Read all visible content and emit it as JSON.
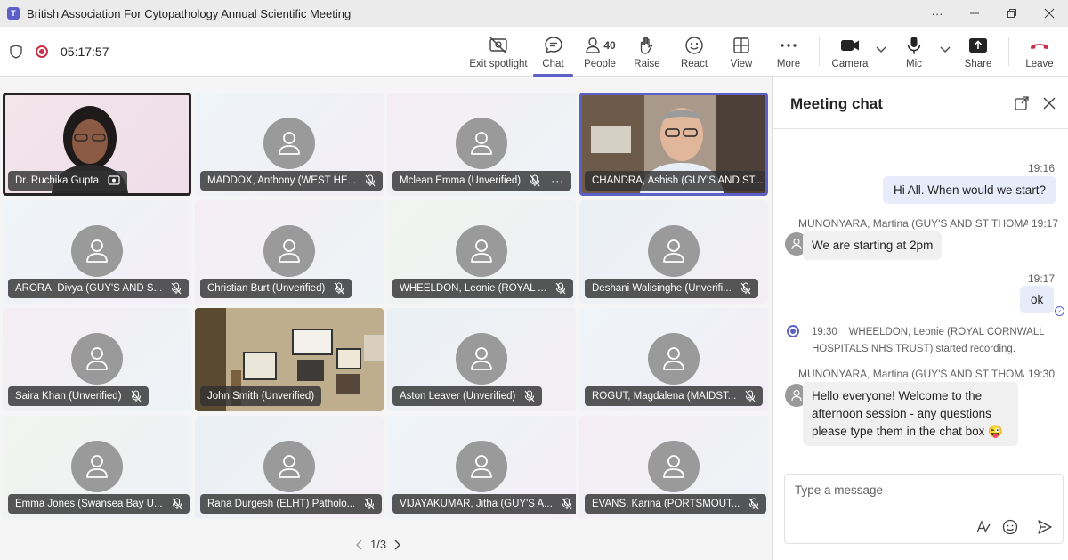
{
  "window": {
    "title": "British Association For Cytopathology Annual Scientific Meeting",
    "controls": [
      "more-options",
      "minimize",
      "restore",
      "close"
    ]
  },
  "toolbar": {
    "timer": "05:17:57",
    "exit_spotlight": "Exit spotlight",
    "chat": "Chat",
    "people": "People",
    "people_count": "40",
    "raise": "Raise",
    "react": "React",
    "view": "View",
    "more": "More",
    "camera": "Camera",
    "mic": "Mic",
    "share": "Share",
    "leave": "Leave"
  },
  "colors": {
    "accent": "#5b5fc7",
    "leave_red": "#c4314b",
    "avatar_gray": "#9a9a9a"
  },
  "participants": [
    {
      "name": "Dr. Ruchika Gupta",
      "video": true
    },
    {
      "name": "MADDOX, Anthony (WEST HE...",
      "video": false
    },
    {
      "name": "Mclean Emma (Unverified)",
      "video": false
    },
    {
      "name": "CHANDRA, Ashish (GUY'S AND ST...",
      "video": true
    },
    {
      "name": "ARORA, Divya (GUY'S AND S...",
      "video": false
    },
    {
      "name": "Christian Burt (Unverified)",
      "video": false
    },
    {
      "name": "WHEELDON, Leonie (ROYAL ...",
      "video": false
    },
    {
      "name": "Deshani Walisinghe (Unverifi...",
      "video": false
    },
    {
      "name": "Saira Khan (Unverified)",
      "video": false
    },
    {
      "name": "John Smith (Unverified)",
      "video": true
    },
    {
      "name": "Aston Leaver (Unverified)",
      "video": false
    },
    {
      "name": "ROGUT, Magdalena (MAIDST...",
      "video": false
    },
    {
      "name": "Emma Jones (Swansea Bay U...",
      "video": false
    },
    {
      "name": "Rana Durgesh (ELHT) Patholo...",
      "video": false
    },
    {
      "name": "VIJAYAKUMAR, Jitha (GUY'S A...",
      "video": false
    },
    {
      "name": "EVANS, Karina (PORTSMOUT...",
      "video": false
    }
  ],
  "pager": {
    "label": "1/3"
  },
  "chat": {
    "title": "Meeting chat",
    "messages": {
      "m1_time": "19:16",
      "m1_text": "Hi All. When would we start?",
      "m2_sender": "MUNONYARA, Martina (GUY'S AND ST THOMAS' I",
      "m2_time": "19:17",
      "m2_text": "We are starting at 2pm",
      "m3_time": "19:17",
      "m3_text": "ok",
      "sys_time": "19:30",
      "sys_text": "WHEELDON, Leonie (ROYAL CORNWALL HOSPITALS NHS TRUST) started recording.",
      "m4_sender": "MUNONYARA, Martina (GUY'S AND ST THOMAS' I",
      "m4_time": "19:30",
      "m4_text": "Hello everyone! Welcome to the afternoon session - any questions please type them in the chat box",
      "m4_emoji": "😜"
    },
    "compose_placeholder": "Type a message"
  }
}
